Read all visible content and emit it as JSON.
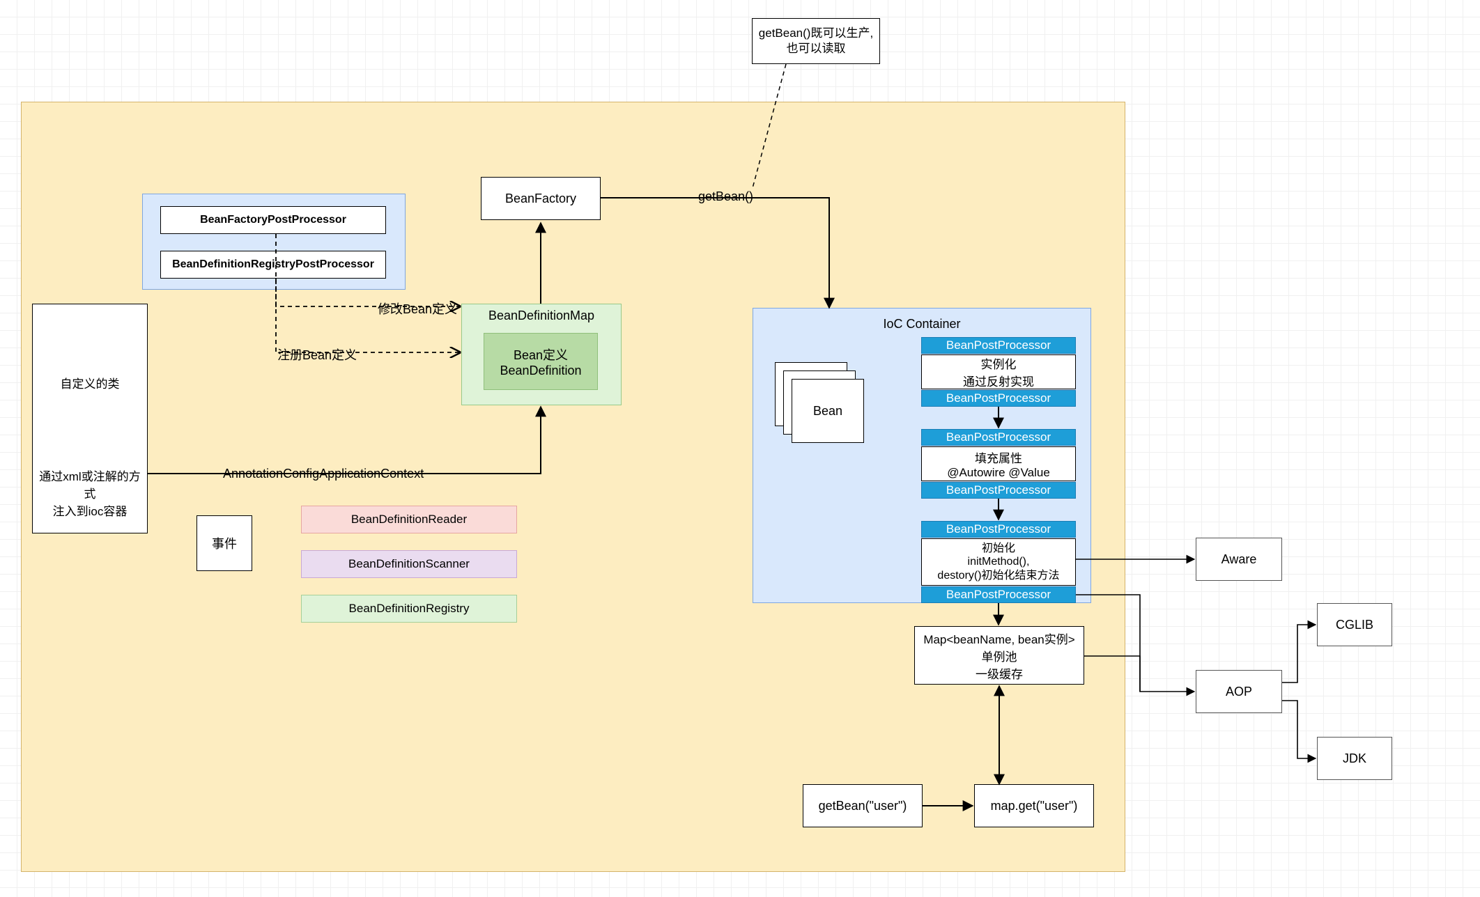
{
  "note": {
    "l1": "getBean()既可以生产,",
    "l2": "也可以读取"
  },
  "boxes": {
    "bean_factory": "BeanFactory",
    "custom_class_1": "自定义的类",
    "custom_class_2": "通过xml或注解的方式",
    "custom_class_3": "注入到ioc容器",
    "event": "事件",
    "bfpp": "BeanFactoryPostProcessor",
    "bdrpp": "BeanDefinitionRegistryPostProcessor",
    "bdm_title": "BeanDefinitionMap",
    "bd_l1": "Bean定义",
    "bd_l2": "BeanDefinition",
    "bd_reader": "BeanDefinitionReader",
    "bd_scanner": "BeanDefinitionScanner",
    "bd_registry": "BeanDefinitionRegistry",
    "ioc_title": "IoC Container",
    "bpp": "BeanPostProcessor",
    "inst_l1": "实例化",
    "inst_l2": "通过反射实现",
    "fill_l1": "填充属性",
    "fill_l2": "@Autowire @Value",
    "init_l1": "初始化",
    "init_l2": "initMethod(),",
    "init_l3": "destory()初始化结束方法",
    "bean": "Bean",
    "map_l1": "Map<beanName, bean实例>",
    "map_l2": "单例池",
    "map_l3": "一级缓存",
    "getbean": "getBean(\"user\")",
    "mapget": "map.get(\"user\")",
    "aware": "Aware",
    "aop": "AOP",
    "cglib": "CGLIB",
    "jdk": "JDK",
    "edge_getbean": "getBean()",
    "edge_modify": "修改Bean定义",
    "edge_register": "注册Bean定义",
    "edge_acac": "AnnotationConfigApplicationContext"
  }
}
